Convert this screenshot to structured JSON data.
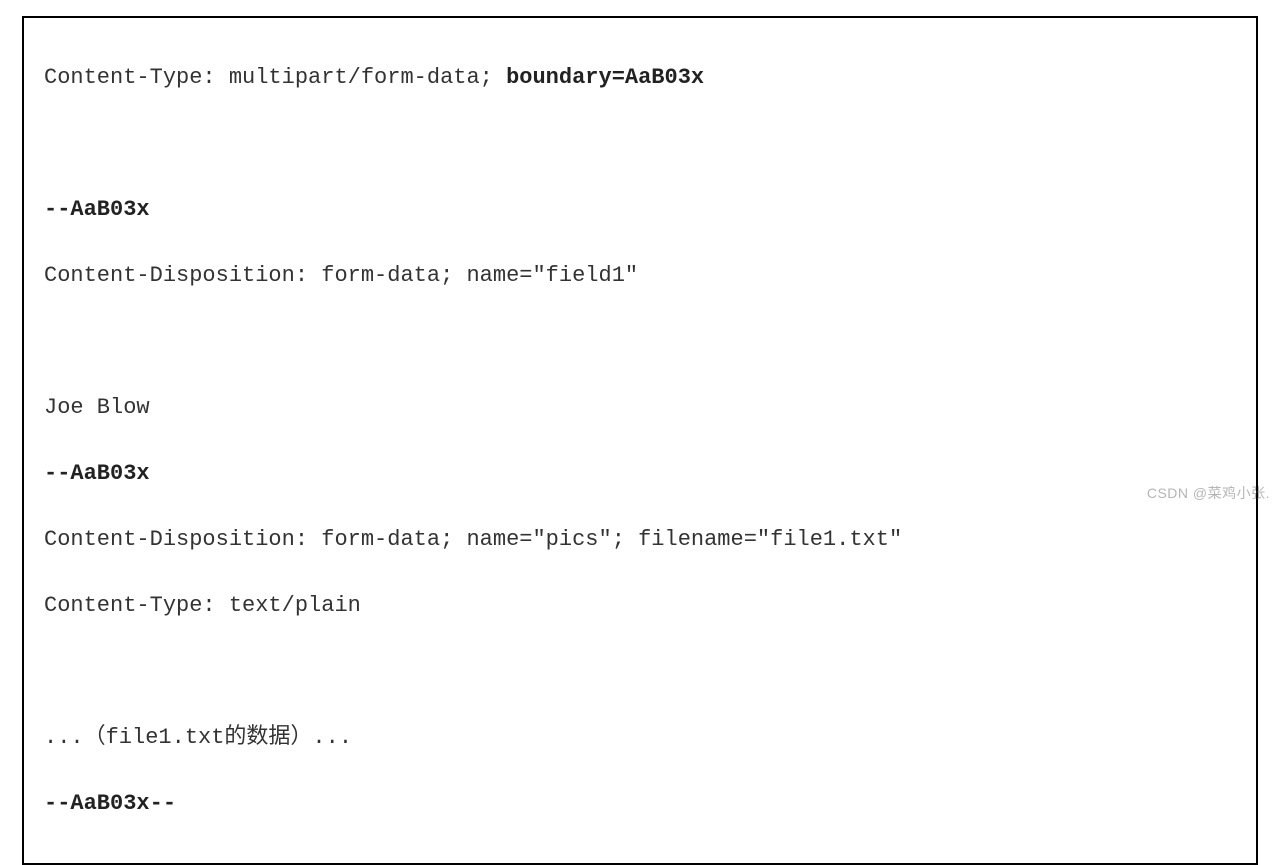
{
  "code": {
    "line1_prefix": "Content-Type: multipart/form-data; ",
    "line1_bold": "boundary=AaB03x",
    "boundary1": "--AaB03x",
    "disp1": "Content-Disposition: form-data; name=\"field1\"",
    "value1": "Joe Blow",
    "boundary2": "--AaB03x",
    "disp2": "Content-Disposition: form-data; name=\"pics\"; filename=\"file1.txt\"",
    "ctype2": "Content-Type: text/plain",
    "filedata": "...（file1.txt的数据）...",
    "closing": "--AaB03x--"
  },
  "watermark": "CSDN @菜鸡小张."
}
